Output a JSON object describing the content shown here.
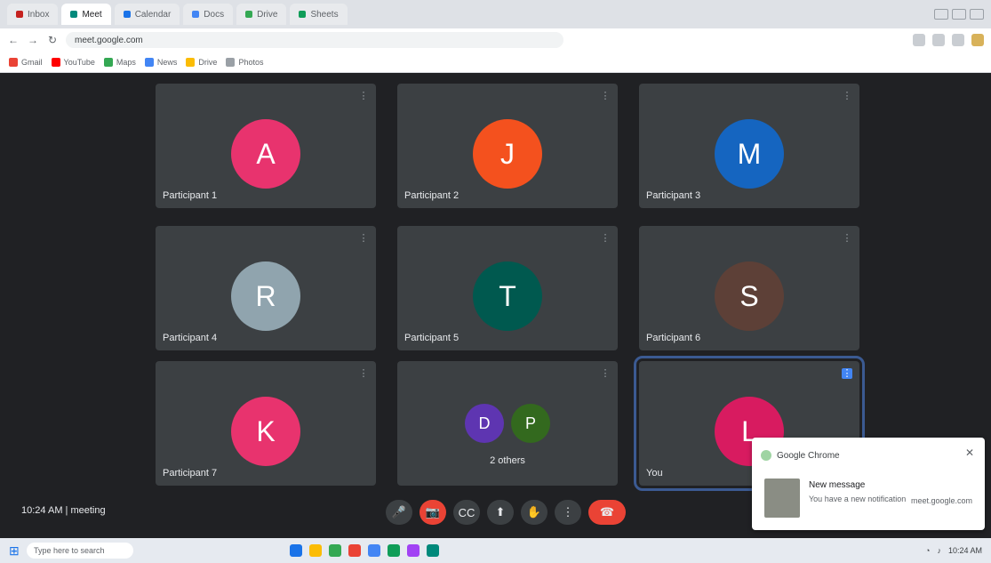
{
  "browser": {
    "tabs": [
      {
        "label": "Inbox",
        "color": "#c5221f",
        "active": false
      },
      {
        "label": "Meet",
        "color": "#00897b",
        "active": true
      },
      {
        "label": "Calendar",
        "color": "#1a73e8",
        "active": false
      },
      {
        "label": "Docs",
        "color": "#4285f4",
        "active": false
      },
      {
        "label": "Drive",
        "color": "#34a853",
        "active": false
      },
      {
        "label": "Sheets",
        "color": "#0f9d58",
        "active": false
      }
    ],
    "url": "meet.google.com",
    "bookmarks": [
      {
        "label": "Gmail",
        "color": "#ea4335"
      },
      {
        "label": "YouTube",
        "color": "#ff0000"
      },
      {
        "label": "Maps",
        "color": "#34a853"
      },
      {
        "label": "News",
        "color": "#4285f4"
      },
      {
        "label": "Drive",
        "color": "#fbbc04"
      },
      {
        "label": "Photos",
        "color": "#9aa0a6"
      }
    ]
  },
  "meet": {
    "participants": [
      {
        "name": "Participant 1",
        "initial": "A",
        "color": "#e8336e"
      },
      {
        "name": "Participant 2",
        "initial": "J",
        "color": "#f4511e"
      },
      {
        "name": "Participant 3",
        "initial": "M",
        "color": "#1565c0"
      },
      {
        "name": "Participant 4",
        "initial": "R",
        "color": "#90a4ae"
      },
      {
        "name": "Participant 5",
        "initial": "T",
        "color": "#00594f"
      },
      {
        "name": "Participant 6",
        "initial": "S",
        "color": "#5d4037"
      },
      {
        "name": "Participant 7",
        "initial": "K",
        "color": "#e8336e"
      },
      {
        "name": "2 others",
        "initial": "",
        "color": "#3c4043"
      },
      {
        "name": "You",
        "initial": "L",
        "color": "#d81b60"
      }
    ],
    "pair_avatars": [
      {
        "initial": "D",
        "color": "#5e35b1"
      },
      {
        "initial": "P",
        "color": "#33691e"
      }
    ],
    "meeting_info": "10:24 AM | meeting",
    "controls": [
      "mic-off",
      "camera-off",
      "captions",
      "present",
      "raise-hand",
      "more",
      "end-call"
    ],
    "control_glyphs": [
      "🎤",
      "📷",
      "CC",
      "⬆",
      "✋",
      "⋮",
      "☎"
    ]
  },
  "notification": {
    "app": "Google Chrome",
    "title": "New message",
    "body": "You have a new notification",
    "site": "meet.google.com"
  },
  "taskbar": {
    "search_placeholder": "Type here to search",
    "time": "10:24 AM",
    "apps": [
      "#1a73e8",
      "#fbbc04",
      "#34a853",
      "#ea4335",
      "#4285f4",
      "#0f9d58",
      "#a142f4",
      "#00897b"
    ]
  }
}
